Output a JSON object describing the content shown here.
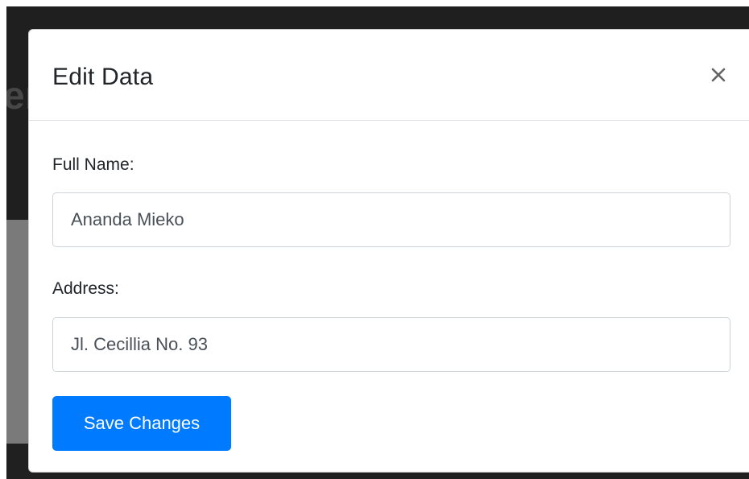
{
  "modal": {
    "title": "Edit Data",
    "close_icon": "close-icon"
  },
  "form": {
    "full_name": {
      "label": "Full Name:",
      "value": "Ananda Mieko"
    },
    "address": {
      "label": "Address:",
      "value": "Jl. Cecillia No. 93"
    },
    "save_label": "Save Changes"
  },
  "colors": {
    "primary": "#007bff",
    "text": "#212529",
    "input_text": "#495057",
    "border": "#ced4da",
    "backdrop_dark": "#1f1f1f",
    "backdrop_content": "#7a7a7a"
  }
}
